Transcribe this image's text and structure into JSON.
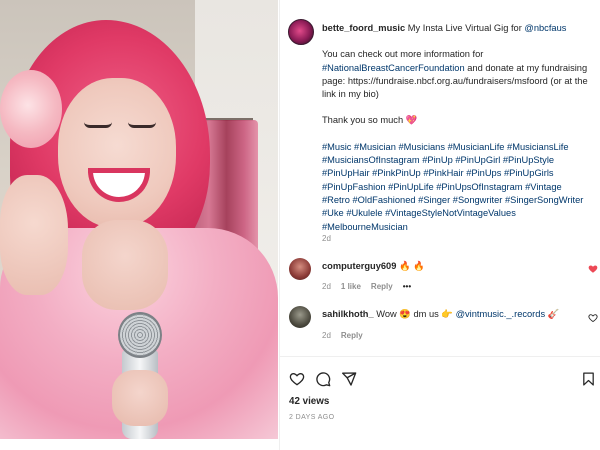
{
  "post": {
    "username": "bette_foord_music",
    "caption_first": "My Insta Live Virtual Gig for",
    "caption_mention": "@nbcfaus",
    "para2_lead": "You can check out more information for",
    "para2_tag": "#NationalBreastCancerFoundation",
    "para2_mid": "and donate at my fundraising page: https://fundraise.nbcf.org.au/fundraisers/msfoord (or at the link in my bio)",
    "thanks": "Thank you so much",
    "hashtags": [
      "#Music",
      "#Musician",
      "#Musicians",
      "#MusicianLife",
      "#MusiciansLife",
      "#MusiciansOfInstagram",
      "#PinUp",
      "#PinUpGirl",
      "#PinUpStyle",
      "#PinUpHair",
      "#PinkPinUp",
      "#PinkHair",
      "#PinUps",
      "#PinUpGirls",
      "#PinUpFashion",
      "#PinUpLife",
      "#PinUpsOfInstagram",
      "#Vintage",
      "#Retro",
      "#OldFashioned",
      "#Singer",
      "#Songwriter",
      "#SingerSongWriter",
      "#Uke",
      "#Ukulele",
      "#VintageStyleNotVintageValues",
      "#MelbourneMusician"
    ],
    "age": "2d"
  },
  "comments": [
    {
      "username": "computerguy609",
      "text": "🔥 🔥",
      "age": "2d",
      "likes": "1 like",
      "reply": "Reply",
      "liked": true
    },
    {
      "username": "sahilkhoth_",
      "text_a": "Wow 😍 dm us 👉",
      "mention": "@vintmusic._.records",
      "text_b": "🎸",
      "age": "2d",
      "reply": "Reply",
      "liked": false
    }
  ],
  "footer": {
    "views": "42 views",
    "time_ago": "2 DAYS AGO"
  },
  "icons": {
    "like": "heart-icon",
    "comment": "comment-icon",
    "share": "send-icon",
    "save": "bookmark-icon",
    "more": "more-icon"
  },
  "colors": {
    "text": "#262626",
    "link": "#00376b",
    "muted": "#8e8e8e",
    "liked_heart": "#ed4956"
  }
}
